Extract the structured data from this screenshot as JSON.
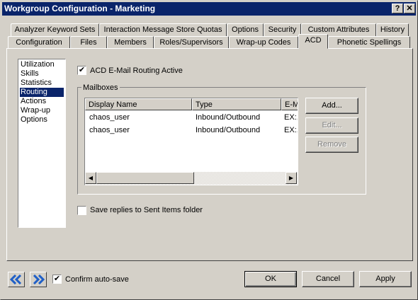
{
  "window": {
    "title": "Workgroup Configuration - Marketing",
    "help_glyph": "?",
    "close_glyph": "✕"
  },
  "tabs_row1": [
    {
      "label": "Analyzer Keyword Sets"
    },
    {
      "label": "Interaction Message Store Quotas"
    },
    {
      "label": "Options"
    },
    {
      "label": "Security"
    },
    {
      "label": "Custom Attributes"
    },
    {
      "label": "History"
    }
  ],
  "tabs_row2": [
    {
      "label": "Configuration"
    },
    {
      "label": "Files"
    },
    {
      "label": "Members"
    },
    {
      "label": "Roles/Supervisors"
    },
    {
      "label": "Wrap-up Codes"
    },
    {
      "label": "ACD",
      "active": true
    },
    {
      "label": "Phonetic Spellings"
    }
  ],
  "sidebar": {
    "items": [
      {
        "label": "Utilization"
      },
      {
        "label": "Skills"
      },
      {
        "label": "Statistics"
      },
      {
        "label": "Routing",
        "selected": true
      },
      {
        "label": "Actions"
      },
      {
        "label": "Wrap-up"
      },
      {
        "label": "Options"
      }
    ]
  },
  "routing": {
    "acd_email_label": "ACD E-Mail Routing Active",
    "acd_email_checked": true,
    "mailboxes_title": "Mailboxes",
    "columns": [
      "Display Name",
      "Type",
      "E-M"
    ],
    "rows": [
      [
        "chaos_user",
        "Inbound/Outbound",
        "EX:,"
      ],
      [
        "chaos_user",
        "Inbound/Outbound",
        "EX:,"
      ]
    ],
    "add_label": "Add...",
    "edit_label": "Edit...",
    "remove_label": "Remove",
    "save_replies_label": "Save replies to Sent Items folder",
    "save_replies_checked": false
  },
  "footer": {
    "confirm_autosave_label": "Confirm auto-save",
    "confirm_autosave_checked": true,
    "ok_label": "OK",
    "cancel_label": "Cancel",
    "apply_label": "Apply"
  },
  "colors": {
    "titlebar": "#0a246a",
    "face": "#d4d0c8",
    "nav_arrow": "#1f5fc7"
  }
}
